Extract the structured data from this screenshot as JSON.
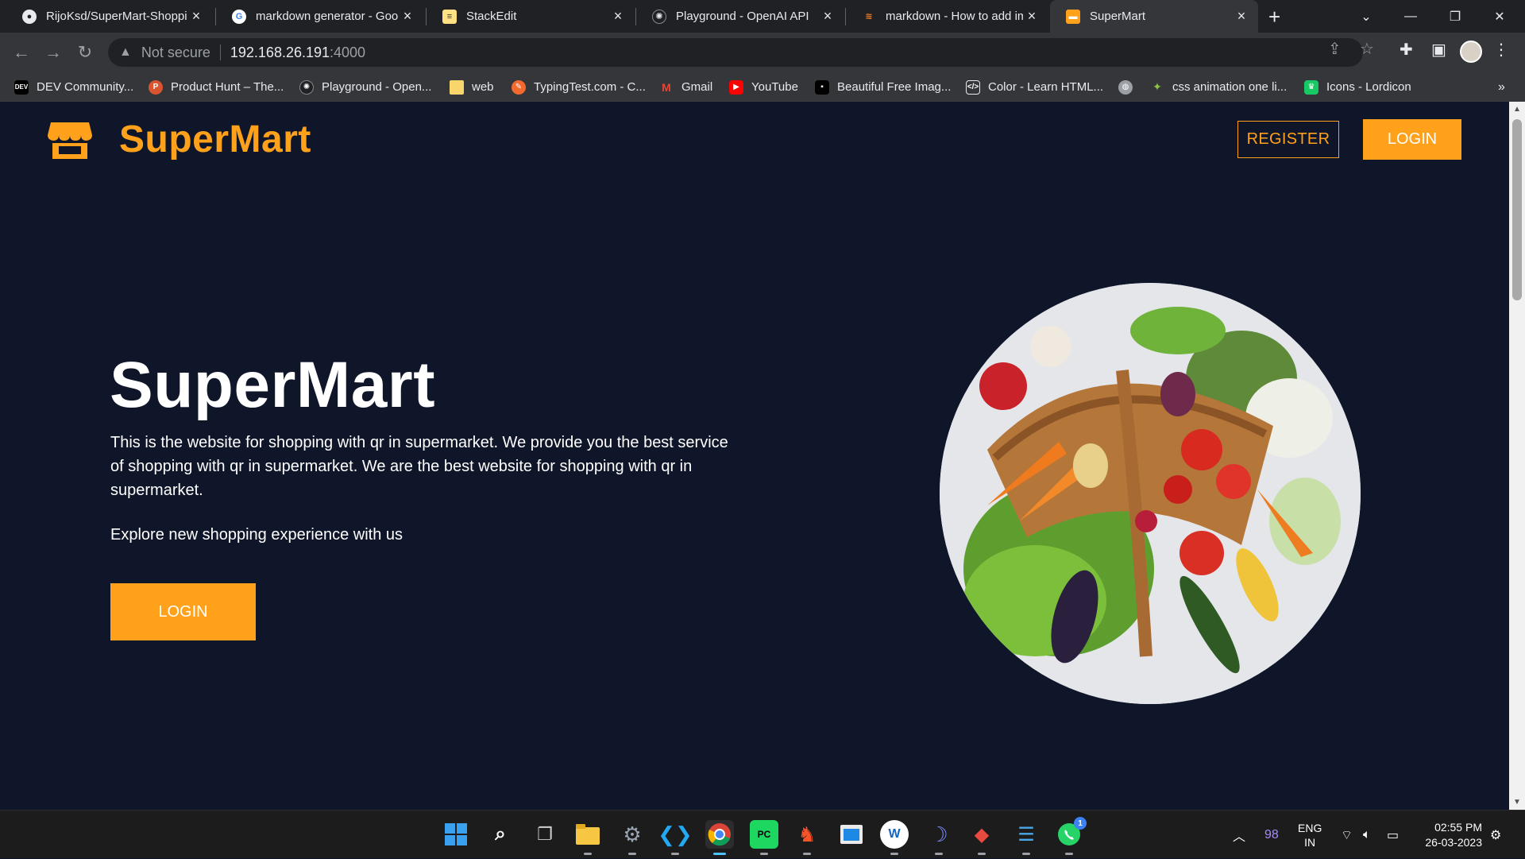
{
  "browser": {
    "tabs": [
      {
        "title": "RijoKsd/SuperMart-Shoppin",
        "icon": "github-icon"
      },
      {
        "title": "markdown generator - Goo",
        "icon": "google-icon"
      },
      {
        "title": "StackEdit",
        "icon": "stackedit-icon"
      },
      {
        "title": "Playground - OpenAI API",
        "icon": "openai-icon"
      },
      {
        "title": "markdown - How to add im",
        "icon": "stackoverflow-icon"
      },
      {
        "title": "SuperMart",
        "icon": "store-icon"
      }
    ],
    "address": {
      "security_label": "Not secure",
      "host": "192.168.26.191",
      "port": ":4000"
    },
    "bookmarks": [
      {
        "label": "DEV Community...",
        "icon": "dev-icon"
      },
      {
        "label": "Product Hunt – The...",
        "icon": "producthunt-icon"
      },
      {
        "label": "Playground - Open...",
        "icon": "openai-icon"
      },
      {
        "label": "web",
        "icon": "folder-icon"
      },
      {
        "label": "TypingTest.com - C...",
        "icon": "typingtest-icon"
      },
      {
        "label": "Gmail",
        "icon": "gmail-icon"
      },
      {
        "label": "YouTube",
        "icon": "youtube-icon"
      },
      {
        "label": "Beautiful Free Imag...",
        "icon": "unsplash-icon"
      },
      {
        "label": "Color - Learn HTML...",
        "icon": "html-icon"
      },
      {
        "label": "",
        "icon": "globe-icon"
      },
      {
        "label": "css animation one li...",
        "icon": "sparkle-icon"
      },
      {
        "label": "Icons - Lordicon",
        "icon": "lordicon-icon"
      }
    ]
  },
  "site": {
    "brand": "SuperMart",
    "register_label": "REGISTER",
    "login_label": "LOGIN",
    "hero": {
      "title": "SuperMart",
      "description": "This is the website for shopping with qr in supermarket. We provide you the best service of shopping with qr in supermarket. We are the best website for shopping with qr in supermarket.",
      "subtitle": "Explore new shopping experience with us",
      "cta_label": "LOGIN",
      "image": "vegetable-basket-image"
    },
    "colors": {
      "accent": "#ffa11a",
      "background": "#0f1629",
      "text": "#ffffff"
    }
  },
  "taskbar": {
    "tray_count": "98",
    "language": "ENG",
    "region": "IN",
    "time": "02:55 PM",
    "date": "26-03-2023",
    "whatsapp_badge": "1"
  }
}
